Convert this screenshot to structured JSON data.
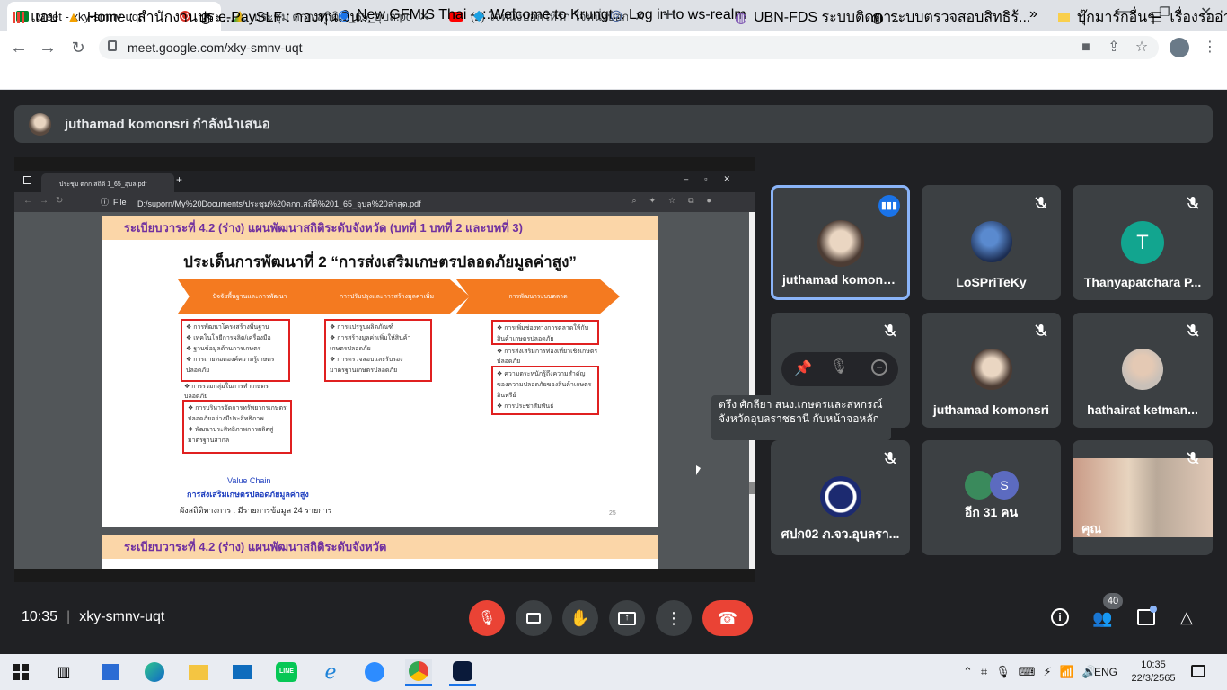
{
  "browser": {
    "tabs": [
      {
        "title": "Meet - xky-smnv-uqt",
        "active": true
      },
      {
        "title": "ประชุม ตกก.สถิติ 1_65_อุบล.pdf - Go",
        "active": false
      },
      {
        "title": "(2) ใจหนึ่งบอกให้รัก ใจหนึ่งบอกให้รอ \"ก",
        "active": false
      }
    ],
    "url": "meet.google.com/xky-smnv-uqt",
    "bookmarks": [
      "แอป",
      "Home : สำนักงานประ...",
      "e-PaySLF : กองทุนเงิน...",
      "New GFMIS Thai – :...",
      "Welcome to Krungt...",
      "Log in to ws-realm",
      "UBN-FDS ระบบติดตา...",
      "ระบบตรวจสอบสิทธิร้...",
      "บุ๊กมาร์กอื่นๆ",
      "เรื่องรออ่าน"
    ]
  },
  "meet": {
    "presenting_banner": "juthamad komonsri กำลังนำเสนอ",
    "meeting_time": "10:35",
    "meeting_code": "xky-smnv-uqt",
    "participant_count": "40",
    "tooltip": "ตรึง ศักลียา สนง.เกษตรและสหกรณ์จังหวัดอุบลราชธานี กับหน้าจอหลัก",
    "tiles": [
      {
        "name": "juthamad komonsri",
        "speaking": true
      },
      {
        "name": "LoSPriTeKy",
        "muted": true
      },
      {
        "name": "Thanyapatchara P...",
        "initial": "T",
        "muted": true
      },
      {
        "name": "",
        "muted": true
      },
      {
        "name": "juthamad komonsri",
        "muted": true
      },
      {
        "name": "hathairat ketman...",
        "muted": true
      },
      {
        "name": "ศปก02 ภ.จว.อุบลรา...",
        "muted": true
      },
      {
        "name": "อีก 31 คน",
        "initial": "S"
      },
      {
        "name": "คุณ",
        "muted": true
      }
    ]
  },
  "pdf": {
    "tab_title": "ประชุม ตกก.สถิติ 1_65_อุบล.pdf",
    "path": "D:/suporn/My%20Documents/ประชุม%20ตกก.สถิติ%201_65_อุบล%20ล่าสุด.pdf",
    "file_label": "File",
    "header": "ระเบียบวาระที่ 4.2 (ร่าง) แผนพัฒนาสถิติระดับจังหวัด (บทที่ 1 บทที่ 2 และบทที่ 3)",
    "header2": "ระเบียบวาระที่ 4.2 (ร่าง) แผนพัฒนาสถิติระดับจังหวัด",
    "title": "ประเด็นการพัฒนาที่ 2 “การส่งเสริมเกษตรปลอดภัยมูลค่าสูง”",
    "arrows": [
      "ปัจจัยพื้นฐานและการพัฒนา",
      "การปรับปรุงและการสร้างมูลค่าเพิ่ม",
      "การพัฒนาระบบตลาด"
    ],
    "col1": [
      "การพัฒนาโครงสร้างพื้นฐาน",
      "เทคโนโลยีการผลิต/เครื่องมือ",
      "ฐานข้อมูลด้านการเกษตร",
      "การถ่ายทอดองค์ความรู้เกษตรปลอดภัย",
      "การรวมกลุ่มในการทำเกษตรปลอดภัย",
      "การบริหารจัดการทรัพยากรเกษตรปลอดภัยอย่างมีประสิทธิภาพ",
      "พัฒนาประสิทธิภาพการผลิตสู่มาตรฐานสากล"
    ],
    "col2": [
      "การแปรรูปผลิตภัณฑ์",
      "การสร้างมูลค่าเพิ่มให้สินค้าเกษตรปลอดภัย",
      "การตรวจสอบและรับรองมาตรฐานเกษตรปลอดภัย"
    ],
    "col3": [
      "การเพิ่มช่องทางการตลาดให้กับสินค้าเกษตรปลอดภัย",
      "การส่งเสริมการท่องเที่ยวเชิงเกษตรปลอดภัย",
      "ความตระหนักรู้ถึงความสำคัญของความปลอดภัยของสินค้าเกษตรอินทรีย์",
      "การประชาสัมพันธ์"
    ],
    "value_chain": "Value Chain",
    "value_chain_sub": "การส่งเสริมเกษตรปลอดภัยมูลค่าสูง",
    "footer": "ผังสถิติทางการ : มีรายการข้อมูล 24 รายการ",
    "page_no": "25"
  },
  "taskbar": {
    "time": "10:35",
    "date": "22/3/2565",
    "lang": "ENG"
  },
  "colors": {
    "accent": "#1a73e8",
    "end_call": "#ea4335",
    "orange": "#f47a20"
  }
}
